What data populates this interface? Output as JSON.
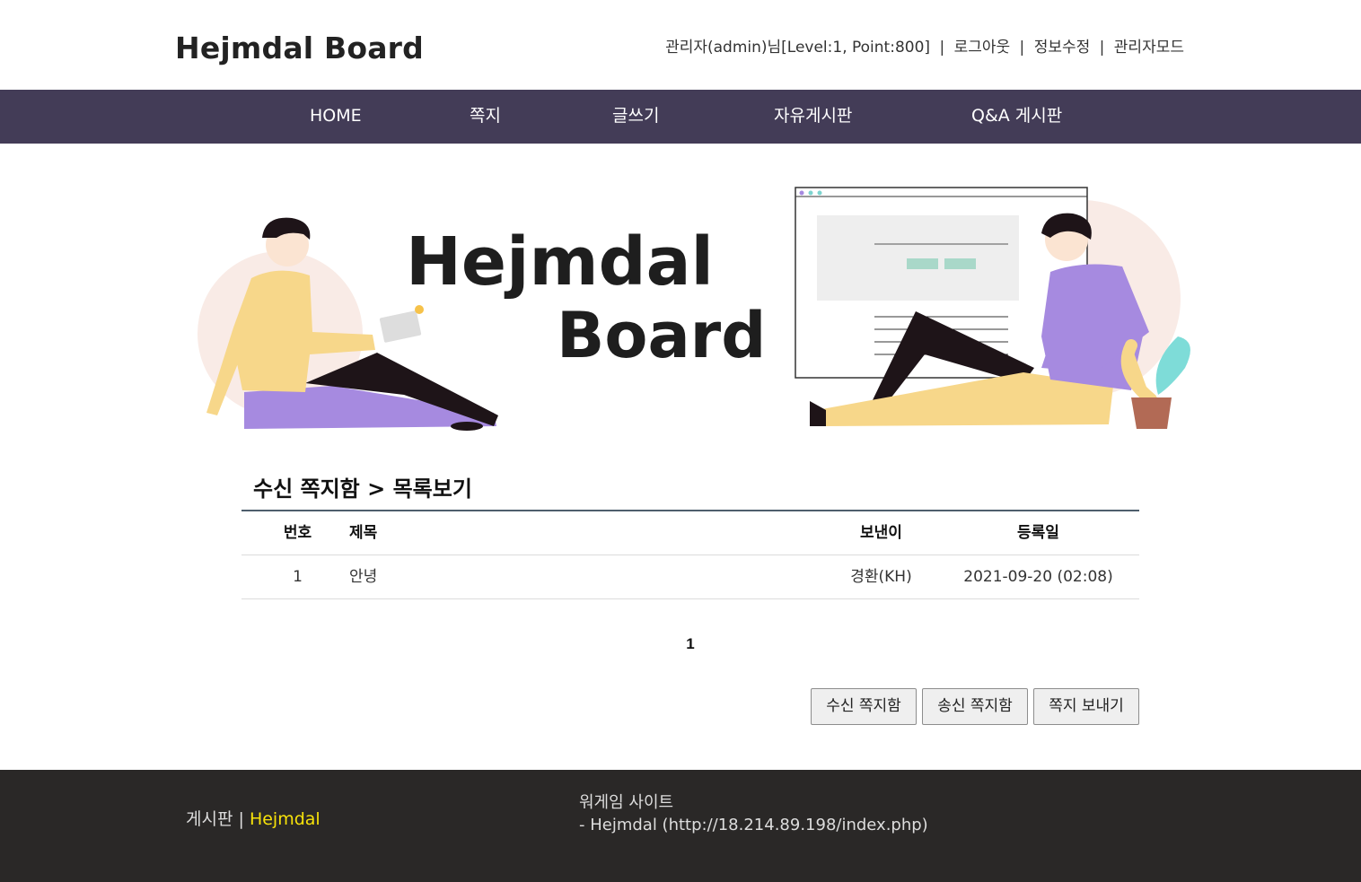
{
  "header": {
    "site_title": "Hejmdal Board",
    "user_info": "관리자(admin)님[Level:1, Point:800]",
    "logout": "로그아웃",
    "edit_profile": "정보수정",
    "admin_mode": "관리자모드",
    "separator": "|"
  },
  "nav": {
    "items": [
      {
        "label": "HOME"
      },
      {
        "label": "쪽지"
      },
      {
        "label": "글쓰기"
      },
      {
        "label": "자유게시판"
      },
      {
        "label": "Q&A 게시판"
      }
    ]
  },
  "banner": {
    "line1": "Hejmdal",
    "line2": "Board"
  },
  "content": {
    "section_title": "수신 쪽지함 > 목록보기",
    "table": {
      "headers": {
        "no": "번호",
        "subject": "제목",
        "sender": "보낸이",
        "date": "등록일"
      },
      "rows": [
        {
          "no": "1",
          "subject": "안녕",
          "sender": "경환(KH)",
          "date": "2021-09-20 (02:08)"
        }
      ]
    },
    "pagination": {
      "current": "1"
    },
    "buttons": {
      "inbox": "수신 쪽지함",
      "outbox": "송신 쪽지함",
      "send": "쪽지 보내기"
    }
  },
  "footer": {
    "left_label": "게시판",
    "left_separator": "|",
    "left_brand": "Hejmdal",
    "right_line1": "워게임 사이트",
    "right_line2": "- Hejmdal (http://18.214.89.198/index.php)"
  },
  "colors": {
    "nav_bg": "#433c57",
    "footer_bg": "#2a2827",
    "footer_brand": "#f7e20a",
    "table_topline": "#4e5e6c"
  }
}
